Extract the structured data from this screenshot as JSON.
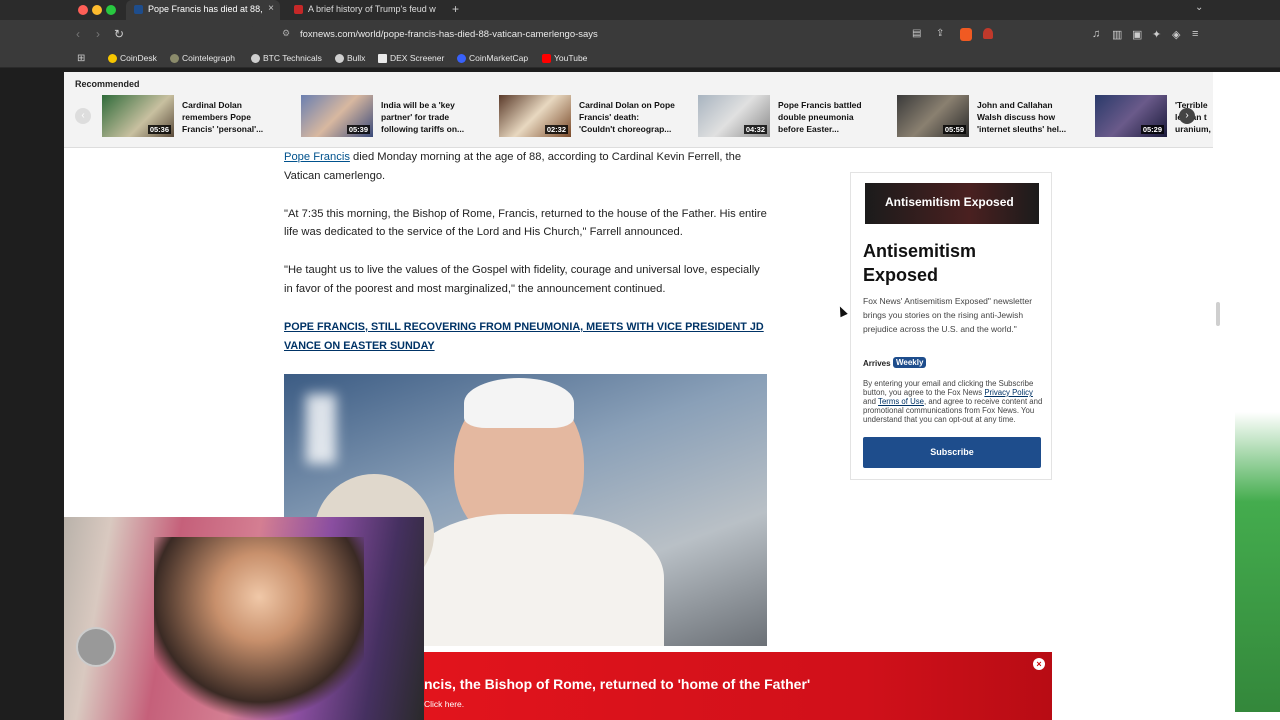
{
  "tabs": [
    {
      "title": "Pope Francis has died at 88,",
      "active": true,
      "close": "×"
    },
    {
      "title": "A brief history of Trump's feud w",
      "active": false
    }
  ],
  "new_tab_label": "+",
  "address": {
    "url": "foxnews.com/world/pope-francis-has-died-88-vatican-camerlengo-says"
  },
  "bookmarks": [
    "CoinDesk",
    "Cointelegraph",
    "BTC Technicals",
    "Bullx",
    "DEX Screener",
    "CoinMarketCap",
    "YouTube"
  ],
  "recommended": {
    "title": "Recommended",
    "items": [
      {
        "text": "Cardinal Dolan remembers Pope Francis' 'personal'...",
        "duration": "05:36"
      },
      {
        "text": "India will be a 'key partner' for trade following tariffs on...",
        "duration": "05:39"
      },
      {
        "text": "Cardinal Dolan on Pope Francis' death: 'Couldn't choreograp...",
        "duration": "02:32"
      },
      {
        "text": "Pope Francis battled double pneumonia before Easter...",
        "duration": "04:32"
      },
      {
        "text": "John and Callahan Walsh discuss how 'internet sleuths' hel...",
        "duration": "05:59"
      },
      {
        "text": "'Terrible le... an t uranium,...",
        "duration": "05:29"
      }
    ]
  },
  "article": {
    "p1_link": "Pope Francis",
    "p1_rest": " died Monday morning at the age of 88, according to Cardinal Kevin Ferrell, the Vatican camerlengo.",
    "p2": "\"At 7:35 this morning, the Bishop of Rome, Francis, returned to the house of the Father. His entire life was dedicated to the service of the Lord and His Church,\" Farrell announced.",
    "p3": "\"He taught us to live the values of the Gospel with fidelity, courage and universal love, especially in favor of the poorest and most marginalized,\" the announcement continued.",
    "related": "POPE FRANCIS, STILL RECOVERING FROM PNEUMONIA, MEETS WITH VICE PRESIDENT JD VANCE ON EASTER SUNDAY"
  },
  "newsletter": {
    "banner": "Antisemitism Exposed",
    "title": "Antisemitism Exposed",
    "description": "Fox News' Antisemitism Exposed\" newsletter brings you stories on the rising anti-Jewish prejudice across the U.S. and the world.\"",
    "arrives_label": "Arrives",
    "frequency": "Weekly",
    "legal_1": "By entering your email and clicking the Subscribe button, you agree to the Fox News ",
    "privacy": "Privacy Policy",
    "legal_and": " and ",
    "terms": "Terms of Use",
    "legal_2": ", and agree to receive content and promotional communications from Fox News. You understand that you can opt-out at any time.",
    "subscribe": "Subscribe"
  },
  "alert": {
    "headline": "ncis, the Bishop of Rome, returned to 'home of the Father'",
    "cta": "Click here.",
    "close": "×"
  },
  "colors": {
    "fox_blue": "#1e4d8c",
    "alert_red": "#e2141c",
    "link": "#00528d"
  }
}
